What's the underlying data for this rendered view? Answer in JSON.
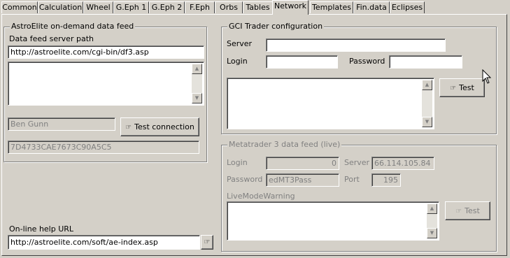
{
  "tabs": [
    "Common",
    "Calculation",
    "Wheel",
    "G.Eph 1",
    "G.Eph 2",
    "F.Eph",
    "Orbs",
    "Tables",
    "Network",
    "Templates",
    "Fin.data",
    "Eclipses"
  ],
  "astroelite": {
    "legend": "AstroElite on-demand data feed",
    "server_path_label": "Data feed server path",
    "server_path_value": "http://astroelite.com/cgi-bin/df3.asp",
    "user_value": "Ben Gunn",
    "test_connection_label": "Test connection",
    "key_value": "7D4733CAE7673C90A5C5"
  },
  "help": {
    "label": "On-line help URL",
    "url_value": "http://astroelite.com/soft/ae-index.asp"
  },
  "gci": {
    "legend": "GCI Trader configuration",
    "server_label": "Server",
    "server_value": "",
    "login_label": "Login",
    "login_value": "",
    "password_label": "Password",
    "password_value": "",
    "test_label": "Test"
  },
  "mt3": {
    "legend": "Metatrader 3 data feed (live)",
    "login_label": "Login",
    "login_value": "0",
    "server_label": "Server",
    "server_value": "66.114.105.84",
    "password_label": "Password",
    "password_value": "edMT3Pass",
    "port_label": "Port",
    "port_value": "195",
    "warning_label": "LiveModeWarning",
    "test_label": "Test"
  },
  "icons": {
    "test_glyph": "hand-pointer-icon",
    "scroll_up": "scroll-up-arrow-icon",
    "scroll_down": "scroll-down-arrow-icon",
    "mouse_cursor": "mouse-cursor-icon"
  }
}
